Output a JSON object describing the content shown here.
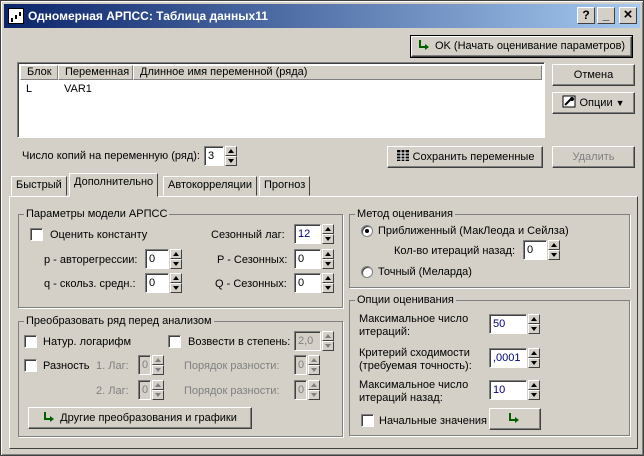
{
  "window": {
    "title": "Одномерная АРПСС: Таблица данных11",
    "help_label": "?",
    "minimize_label": "_",
    "close_label": "×"
  },
  "actions": {
    "ok_label": "OK (Начать оценивание параметров)",
    "cancel_label": "Отмена",
    "options_label": "Опции",
    "save_vars_label": "Сохранить переменные",
    "delete_label": "Удалить",
    "copies_label": "Число копий на переменную (ряд):",
    "copies_value": "3"
  },
  "variables_table": {
    "columns": [
      "Блок",
      "Переменная",
      "Длинное имя переменной (ряда)"
    ],
    "rows": [
      [
        "L",
        "VAR1",
        ""
      ]
    ]
  },
  "tabs": [
    {
      "label": "Быстрый",
      "active": false
    },
    {
      "label": "Дополнительно",
      "active": true
    },
    {
      "label": "Автокорреляции",
      "active": false
    },
    {
      "label": "Прогноз",
      "active": false
    }
  ],
  "model_params": {
    "title": "Параметры модели АРПСС",
    "estimate_const_label": "Оценить константу",
    "p_label": "p - авторегрессии:",
    "p_value": "0",
    "q_label": "q - скольз. средн.:",
    "q_value": "0",
    "seasonal_lag_label": "Сезонный лаг:",
    "seasonal_lag_value": "12",
    "P_label": "P - Сезонных:",
    "P_value": "0",
    "Q_label": "Q - Сезонных:",
    "Q_value": "0"
  },
  "transform": {
    "title": "Преобразовать ряд перед анализом",
    "natlog_label": "Натур. логарифм",
    "power_label": "Возвести в степень:",
    "power_value": "2,0",
    "diff_label": "Разность",
    "lag1_label": "1. Лаг:",
    "lag1_value": "0",
    "order1_label": "Порядок разности:",
    "order1_value": "0",
    "lag2_label": "2. Лаг:",
    "lag2_value": "0",
    "order2_label": "Порядок разности:",
    "order2_value": "0",
    "other_button_label": "Другие преобразования и графики"
  },
  "estimation_method": {
    "title": "Метод оценивания",
    "approx_label": "Приближенный (МакЛеода и Сейлза)",
    "approx_selected": true,
    "backcast_label": "Кол-во итераций назад:",
    "backcast_value": "0",
    "exact_label": "Точный (Меларда)"
  },
  "estimation_options": {
    "title": "Опции оценивания",
    "max_iter_label_1": "Максимальное число",
    "max_iter_label_2": "итераций:",
    "max_iter_value": "50",
    "conv_label_1": "Критерий сходимости",
    "conv_label_2": "(требуемая точность):",
    "conv_value": ",0001",
    "max_back_label_1": "Максимальное число",
    "max_back_label_2": "итераций назад:",
    "max_back_value": "10",
    "initial_values_label": "Начальные значения"
  },
  "colors": {
    "face": "#d4d0c8",
    "title_start": "#0a246a",
    "title_end": "#a6caf0",
    "input_value": "#00007f"
  }
}
